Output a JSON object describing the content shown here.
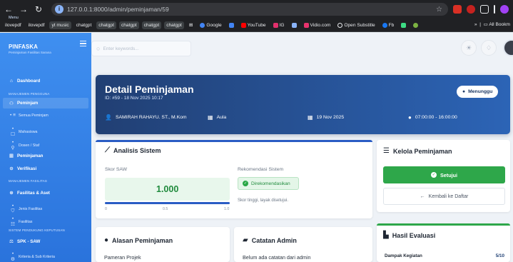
{
  "browser": {
    "url": "127.0.0.1:8000/admin/peminjaman/59",
    "bookmarks": [
      "ilovepdf",
      "ilovepdf",
      "yt music",
      "chatgpt",
      "chatgpt",
      "chatgpt",
      "chatgpt",
      "chatgpt",
      "Google",
      "YouTube",
      "IG",
      "Vidio.com",
      "Open Substitle",
      "Fb"
    ],
    "all_bookmarks": "All Bookm"
  },
  "sidebar": {
    "brand_small": "Menu",
    "brand": "PINFASKA",
    "brand_sub": "Peminjaman Fasilitas Sarana",
    "items": [
      {
        "label": "Dashboard",
        "icon": "home-icon"
      },
      {
        "section": "MANAJEMEN PENGGUNA"
      },
      {
        "label": "Peminjam",
        "icon": "users-icon"
      },
      {
        "label": "Semua Peminjam",
        "icon": "list-icon"
      },
      {
        "label": "Mahasiswa",
        "icon": "student-icon"
      },
      {
        "label": "Dosen / Staf",
        "icon": "staff-icon"
      },
      {
        "label": "Peminjaman",
        "icon": "calendar-icon"
      },
      {
        "label": "Verifikasi",
        "icon": "check-icon"
      },
      {
        "section": "MANAJEMEN FASILITAS"
      },
      {
        "label": "Fasilitas & Aset",
        "icon": "box-icon"
      },
      {
        "label": "Jenis Fasilitas",
        "icon": "tag-icon"
      },
      {
        "label": "Fasilitas",
        "icon": "building-icon"
      },
      {
        "section": "SISTEM PENDUKUNG KEPUTUSAN"
      },
      {
        "label": "SPK - SAW",
        "icon": "chart-icon"
      },
      {
        "label": "Kriteria & Sub Kriteria",
        "icon": "filter-icon"
      }
    ]
  },
  "topbar": {
    "search_placeholder": "Enter keywords..."
  },
  "header": {
    "title": "Detail Peminjaman",
    "subtitle": "ID: #59 - 18 Nov 2025 10:17",
    "status": "Menunggu",
    "borrower": "SAMIRAH RAHAYU. ST., M.Kom",
    "facility": "Aula",
    "date": "19 Nov 2025",
    "time": "07:00:00 - 16:00:00"
  },
  "analysis": {
    "title": "Analisis Sistem",
    "score_label": "Skor SAW",
    "score_value": "1.000",
    "score_fraction": 1.0,
    "ticks": [
      "0",
      "0.5",
      "1.0"
    ],
    "rec_label": "Rekomendasi Sistem",
    "rec_value": "Direkomendasikan",
    "rec_note": "Skor tinggi, layak disetujui."
  },
  "manage": {
    "title": "Kelola Peminjaman",
    "approve_label": "Setujui",
    "back_label": "Kembali ke Daftar"
  },
  "reason": {
    "title": "Alasan Peminjaman",
    "text": "Pameran Projek"
  },
  "notes": {
    "title": "Catatan Admin",
    "text": "Belum ada catatan dari admin"
  },
  "evaluation": {
    "title": "Hasil Evaluasi",
    "rows": [
      {
        "label": "Dampak Kegiatan",
        "score": "5/10"
      }
    ]
  },
  "colors": {
    "sidebar": "#3f8ff0",
    "hero": "#213f73",
    "success": "#2ea74a"
  }
}
